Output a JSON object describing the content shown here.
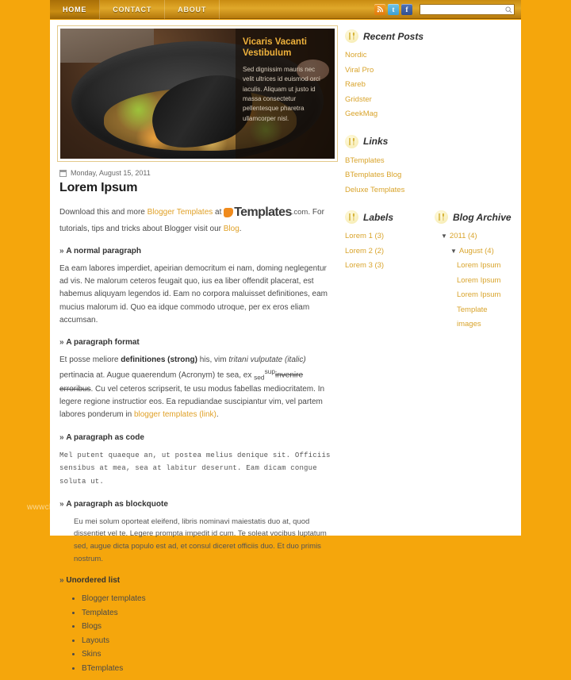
{
  "theme": {
    "background": "#f5a60c",
    "accent": "#d9a42c",
    "bar_gradient_top": "#e0a82a",
    "bar_gradient_bottom": "#b5790c"
  },
  "topbar": {
    "nav": [
      {
        "label": "HOME",
        "active": true
      },
      {
        "label": "CONTACT",
        "active": false
      },
      {
        "label": "ABOUT",
        "active": false
      }
    ],
    "social": [
      {
        "name": "rss-icon",
        "glyph": "◔",
        "color": "#e07a0c"
      },
      {
        "name": "twitter-icon",
        "glyph": "t",
        "color": "#3f9fd0"
      },
      {
        "name": "facebook-icon",
        "glyph": "f",
        "color": "#32508f"
      }
    ],
    "search": {
      "value": "",
      "placeholder": "",
      "icon": "search-icon"
    }
  },
  "slider": {
    "caption_title": "Vicaris Vacanti Vestibulum",
    "caption_text": "Sed dignissim mauris nec velit ultrices id euismod orci iaculis. Aliquam ut justo id massa consectetur pellentesque pharetra ullamcorper nisl."
  },
  "post": {
    "date": "Monday, August 15, 2011",
    "title": "Lorem Ipsum",
    "intro_1": "Download this and more ",
    "intro_link_1": "Blogger Templates",
    "intro_2": " at ",
    "brand": "Templates",
    "brand_suffix": ".com",
    "intro_3": ". For tutorials, tips and tricks about Blogger visit our ",
    "intro_link_2": "Blog",
    "intro_4": ".",
    "h_normal": "A normal paragraph",
    "p_normal": "Ea eam labores imperdiet, apeirian democritum ei nam, doming neglegentur ad vis. Ne malorum ceteros feugait quo, ius ea liber offendit placerat, est habemus aliquyam legendos id. Eam no corpora maluisset definitiones, eam mucius malorum id. Quo ea idque commodo utroque, per ex eros eliam accumsan.",
    "h_format": "A paragraph format",
    "fmt_1": "Et posse meliore ",
    "fmt_strong": "definitiones (strong)",
    "fmt_2": " his, vim ",
    "fmt_italic": "tritani vulputate (italic)",
    "fmt_3": " pertinacia at. Augue quaerendum (Acronym) te sea, ex ",
    "fmt_sub": "sed",
    "fmt_sup": "sup",
    "fmt_strike": "invenire erroribus",
    "fmt_4": ". Cu vel ceteros scripserit, te usu modus fabellas mediocritatem. In legere regione instructior eos. Ea repudiandae suscipiantur vim, vel partem labores ponderum in ",
    "fmt_link": "blogger templates (link)",
    "fmt_5": ".",
    "h_code": "A paragraph as code",
    "code_text": "Mel putent quaeque an, ut postea melius denique sit. Officiis sensibus at mea, sea at labitur deserunt. Eam dicam congue soluta ut.",
    "h_quote": "A paragraph as blockquote",
    "quote_text": "Eu mei solum oporteat eleifend, libris nominavi maiestatis duo at, quod dissentiet vel te. Legere prompta impedit id cum. Te soleat vocibus luptatum sed, augue dicta populo est ad, et consul diceret officiis duo. Et duo primis nostrum.",
    "h_list": "Unordered list",
    "list_items": [
      "Blogger templates",
      "Templates",
      "Blogs",
      "Layouts",
      "Skins",
      "BTemplates"
    ]
  },
  "sidebar": {
    "recent_posts": {
      "title": "Recent Posts",
      "icon": "cutlery-icon",
      "items": [
        "Nordic",
        "Viral Pro",
        "Rareb",
        "Gridster",
        "GeekMag"
      ]
    },
    "links": {
      "title": "Links",
      "icon": "cutlery-icon",
      "items": [
        "BTemplates",
        "BTemplates Blog",
        "Deluxe Templates"
      ]
    },
    "labels": {
      "title": "Labels",
      "icon": "cutlery-icon",
      "items": [
        "Lorem 1 (3)",
        "Lorem 2 (2)",
        "Lorem 3 (3)"
      ]
    },
    "archive": {
      "title": "Blog Archive",
      "icon": "cutlery-icon",
      "year": "2011 (4)",
      "month": "August (4)",
      "entries": [
        "Lorem Ipsum",
        "Lorem Ipsum",
        "Lorem Ipsum",
        "Template images"
      ]
    }
  },
  "watermark": "wwwcher"
}
